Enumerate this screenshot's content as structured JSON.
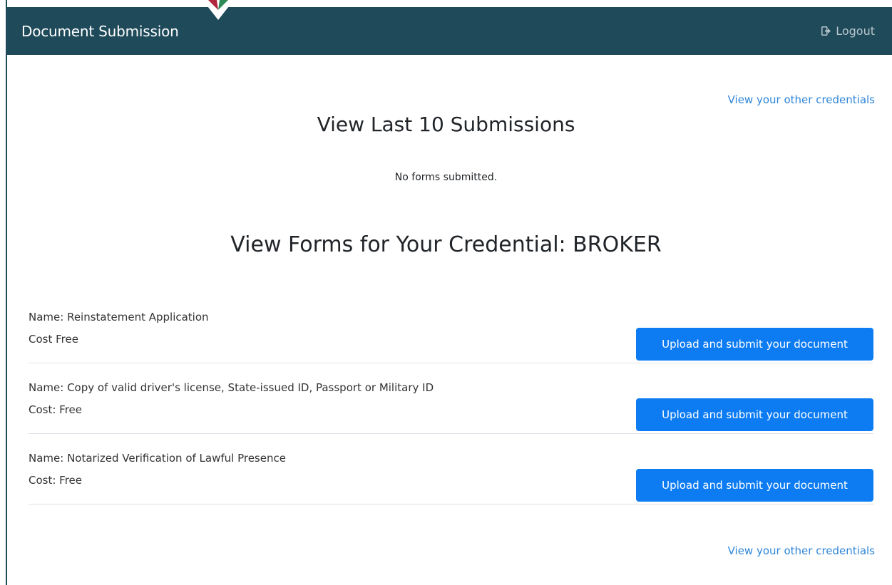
{
  "header": {
    "title": "Document Submission",
    "logout_label": "Logout",
    "logout_icon": "sign-out-icon",
    "brand_colors": {
      "header_bg": "#1f4a5a",
      "logo_green": "#2e8b57",
      "logo_red": "#b0263a"
    }
  },
  "links": {
    "other_credentials": "View your other credentials"
  },
  "recent": {
    "title": "View Last 10 Submissions",
    "empty_message": "No forms submitted."
  },
  "forms_section": {
    "title": "View Forms for Your Credential: BROKER",
    "button_color": "#0d7cf2",
    "forms": [
      {
        "name_line": "Name: Reinstatement Application",
        "cost_line": "Cost  Free",
        "button_label": "Upload and submit your document"
      },
      {
        "name_line": "Name: Copy of valid driver's license, State-issued ID, Passport or Military ID",
        "cost_line": "Cost: Free",
        "button_label": "Upload and submit your document"
      },
      {
        "name_line": "Name: Notarized Verification of Lawful Presence",
        "cost_line": "Cost: Free",
        "button_label": "Upload and submit your document"
      }
    ]
  }
}
